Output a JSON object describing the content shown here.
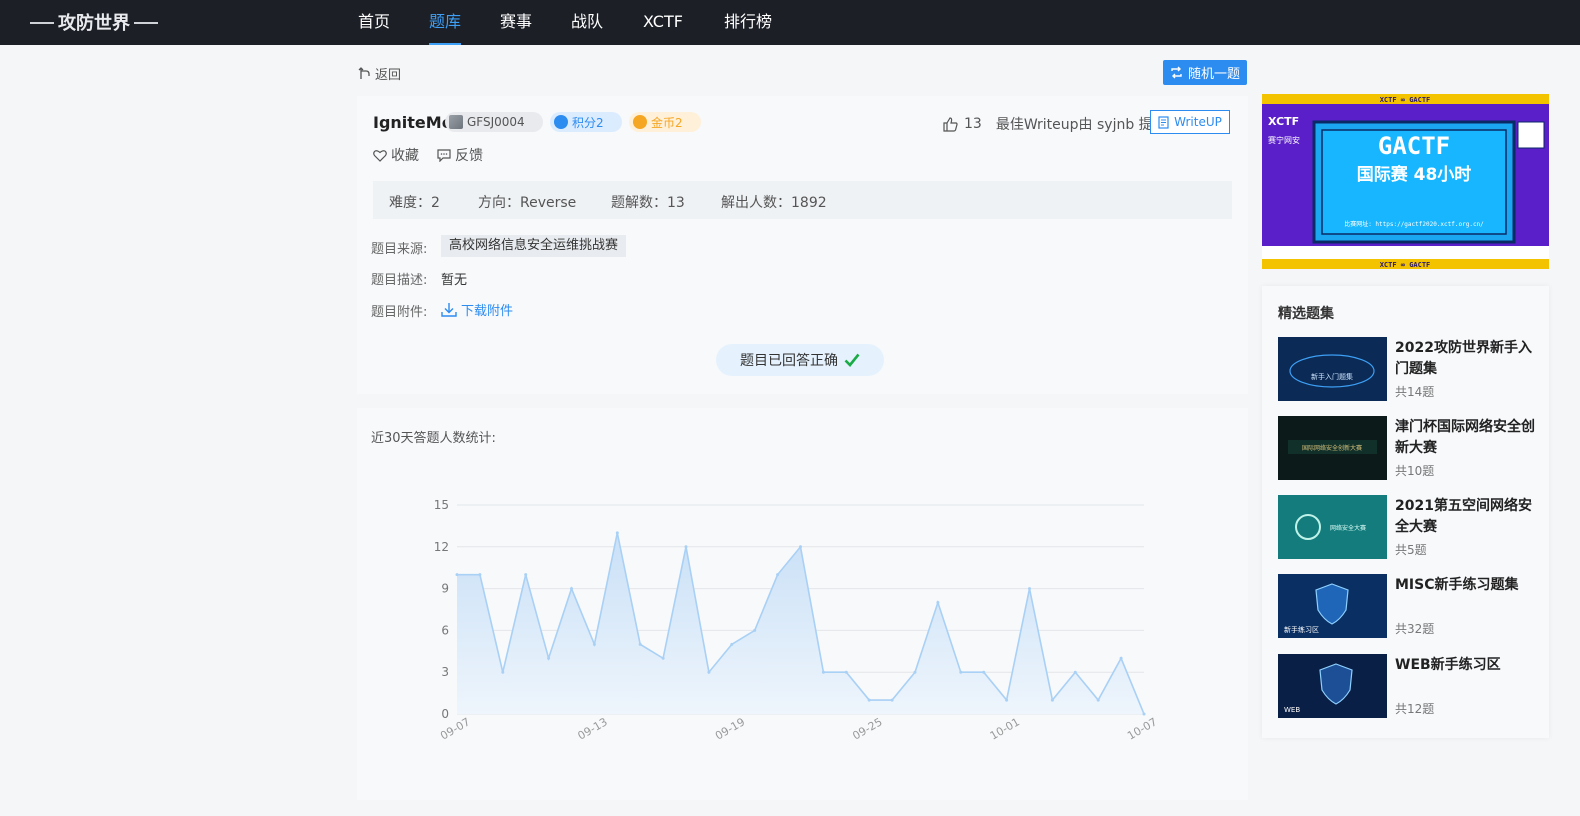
{
  "nav": {
    "logo_alt": "攻防世界",
    "items": [
      {
        "label": "首页",
        "active": false
      },
      {
        "label": "题库",
        "active": true
      },
      {
        "label": "赛事",
        "active": false
      },
      {
        "label": "战队",
        "active": false
      },
      {
        "label": "XCTF",
        "active": false
      },
      {
        "label": "排行榜",
        "active": false
      }
    ]
  },
  "toolbar": {
    "back_label": "返回",
    "random_label": "随机一题"
  },
  "challenge": {
    "title": "IgniteMe",
    "code": "GFSJ0004",
    "score": "积分2",
    "gold": "金币2",
    "likes": "13",
    "best_writeup": "最佳Writeup由 syjnb 提供",
    "writeup_label": "WriteUP",
    "favorite_label": "收藏",
    "feedback_label": "反馈",
    "stats": {
      "difficulty": "难度：2",
      "direction": "方向：Reverse",
      "writeups": "题解数：13",
      "solvers": "解出人数：1892"
    },
    "source_label": "题目来源:",
    "source_value": "高校网络信息安全运维挑战赛",
    "desc_label": "题目描述:",
    "desc_value": "暂无",
    "attach_label": "题目附件:",
    "attach_link": "下载附件",
    "status": "题目已回答正确"
  },
  "chart_data": {
    "type": "area",
    "title": "近30天答题人数统计:",
    "x": [
      "09-07",
      "09-08",
      "09-09",
      "09-10",
      "09-11",
      "09-12",
      "09-13",
      "09-14",
      "09-15",
      "09-16",
      "09-17",
      "09-18",
      "09-19",
      "09-20",
      "09-21",
      "09-22",
      "09-23",
      "09-24",
      "09-25",
      "09-26",
      "09-27",
      "09-28",
      "09-29",
      "09-30",
      "10-01",
      "10-02",
      "10-03",
      "10-04",
      "10-05",
      "10-06",
      "10-07"
    ],
    "xticks": [
      "09-07",
      "09-13",
      "09-19",
      "09-25",
      "10-01",
      "10-07"
    ],
    "series": [
      {
        "values": [
          10,
          10,
          3,
          10,
          4,
          9,
          5,
          13,
          5,
          4,
          12,
          3,
          5,
          6,
          10,
          12,
          3,
          3,
          1,
          1,
          3,
          8,
          3,
          3,
          1,
          9,
          1,
          3,
          1,
          4,
          0
        ]
      }
    ],
    "yticks": [
      0,
      3,
      6,
      9,
      12,
      15
    ],
    "ylim": [
      0,
      15
    ],
    "grid": true,
    "colors": {
      "line": "#a9d0f5",
      "fill_top": "#c9e0f7",
      "fill_bottom": "#eef5fc"
    }
  },
  "sidebar": {
    "banner": {
      "strip": "XCTF ∞ GACTF",
      "brand": "XCTF",
      "brand2": "赛宁网安",
      "headline": "GACTF",
      "subline": "国际赛 48小时",
      "url": "比赛网址: https://gactf2020.xctf.org.cn/"
    },
    "sets_title": "精选题集",
    "sets": [
      {
        "name": "2022攻防世界新手入门题集",
        "count": "共14题",
        "thumb_text": "新手入门题集",
        "thumb_color": "#0b2a55"
      },
      {
        "name": "津门杯国际网络安全创新大赛",
        "count": "共10题",
        "thumb_text": "国际网络安全创新大赛",
        "thumb_color": "#0d1a1a"
      },
      {
        "name": "2021第五空间网络安全大赛",
        "count": "共5题",
        "thumb_text": "网络安全大赛",
        "thumb_color": "#147c7c"
      },
      {
        "name": "MISC新手练习题集",
        "count": "共32题",
        "thumb_text": "新手练习区",
        "thumb_color": "#0a2f63"
      },
      {
        "name": "WEB新手练习区",
        "count": "共12题",
        "thumb_text": "WEB",
        "thumb_color": "#0a1f45"
      }
    ]
  }
}
